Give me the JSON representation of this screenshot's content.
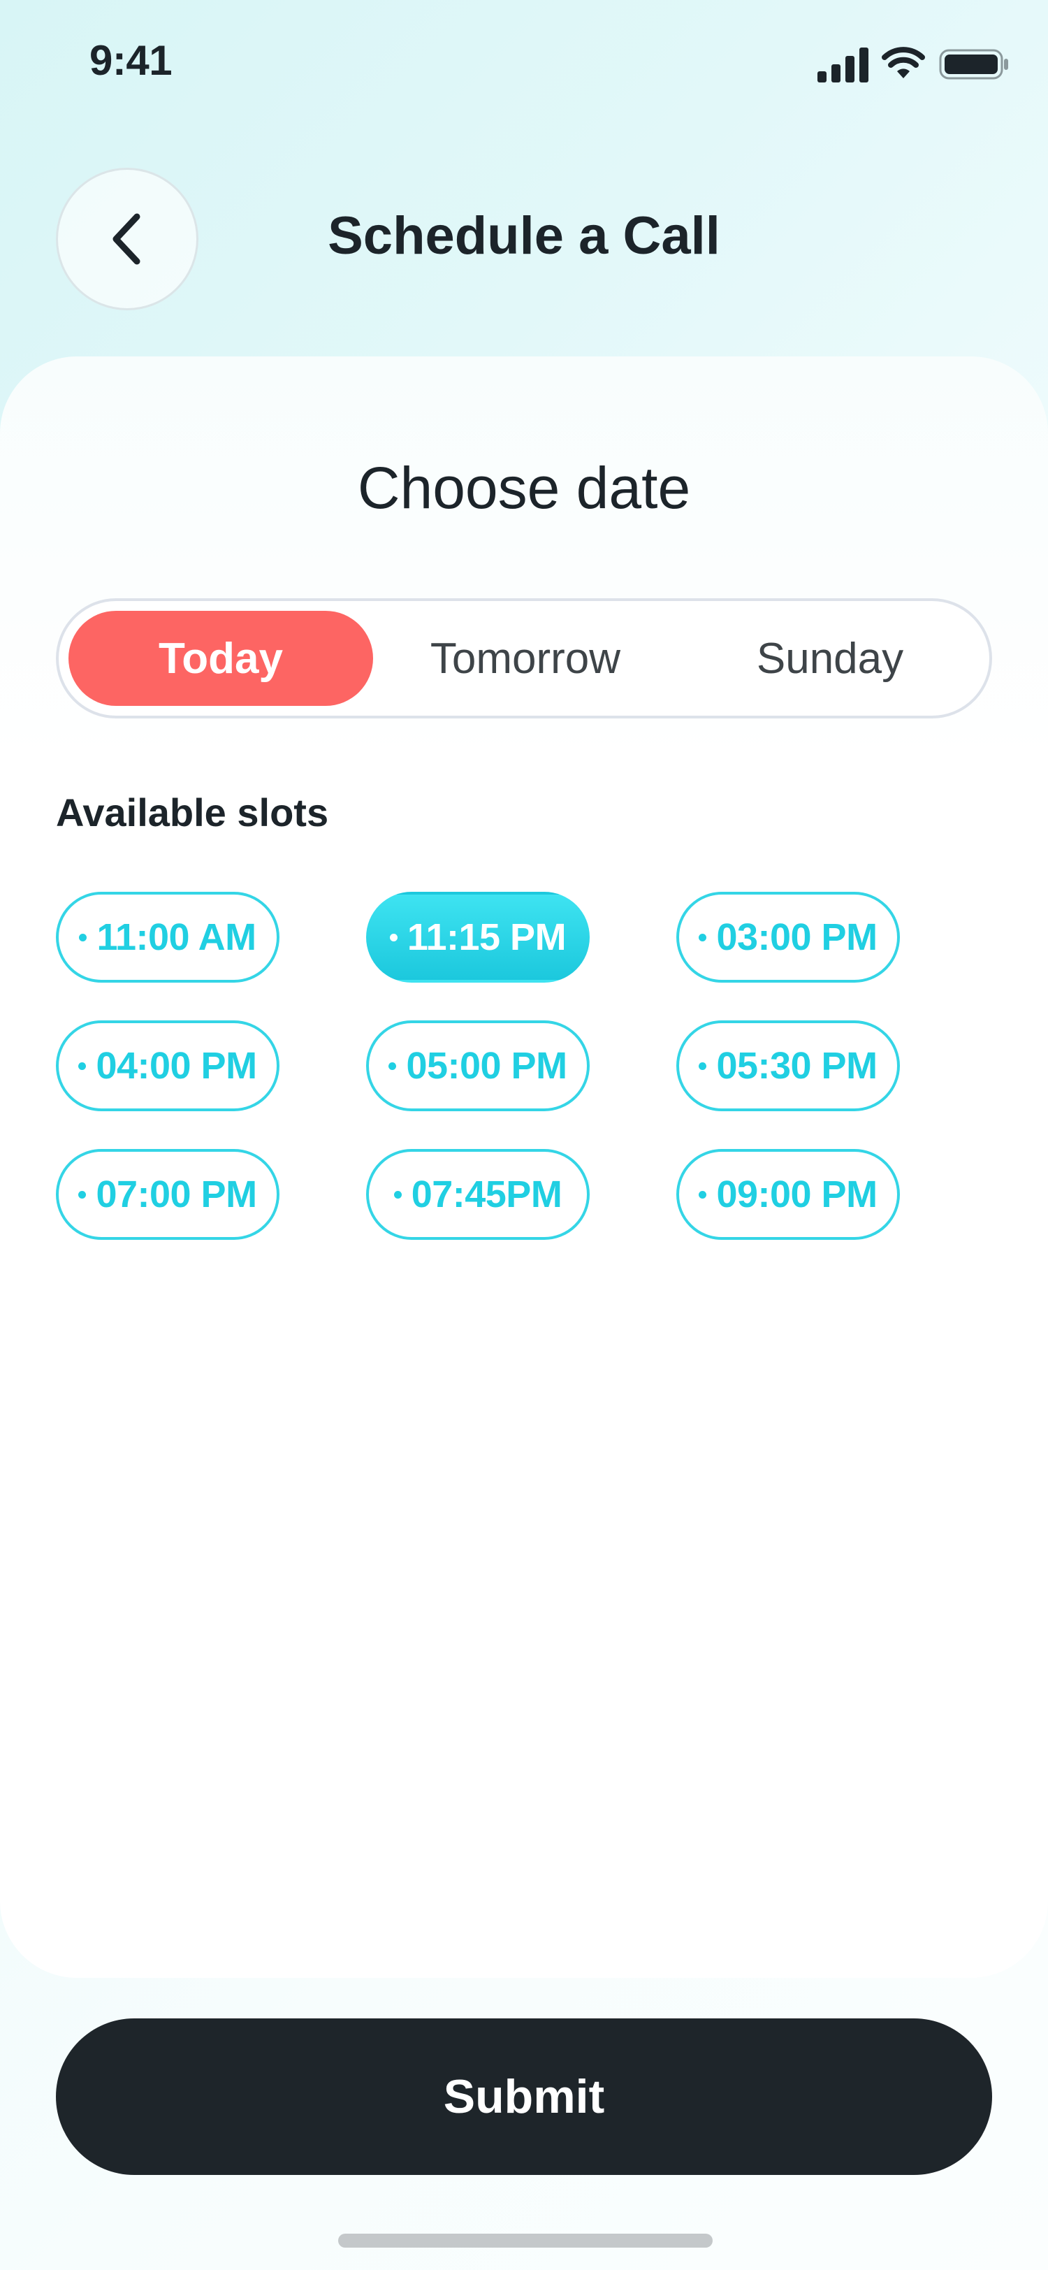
{
  "status_bar": {
    "time": "9:41",
    "icons": [
      "signal-icon",
      "wifi-icon",
      "battery-icon"
    ]
  },
  "header": {
    "back_icon": "chevron-left-icon",
    "title": "Schedule a Call"
  },
  "main": {
    "section_title": "Choose date",
    "date_tabs": [
      {
        "label": "Today",
        "selected": true
      },
      {
        "label": "Tomorrow",
        "selected": false
      },
      {
        "label": "Sunday",
        "selected": false
      }
    ],
    "slots_label": "Available slots",
    "slots": [
      {
        "label": "11:00 AM",
        "selected": false
      },
      {
        "label": "11:15 PM",
        "selected": true
      },
      {
        "label": "03:00 PM",
        "selected": false
      },
      {
        "label": "04:00 PM",
        "selected": false
      },
      {
        "label": "05:00 PM",
        "selected": false
      },
      {
        "label": "05:30 PM",
        "selected": false
      },
      {
        "label": "07:00 PM",
        "selected": false
      },
      {
        "label": "07:45PM",
        "selected": false
      },
      {
        "label": "09:00 PM",
        "selected": false
      }
    ]
  },
  "submit": {
    "label": "Submit"
  },
  "colors": {
    "accent_coral": "#fd6563",
    "accent_cyan": "#20cfe2",
    "dark_button": "#1e252a"
  }
}
